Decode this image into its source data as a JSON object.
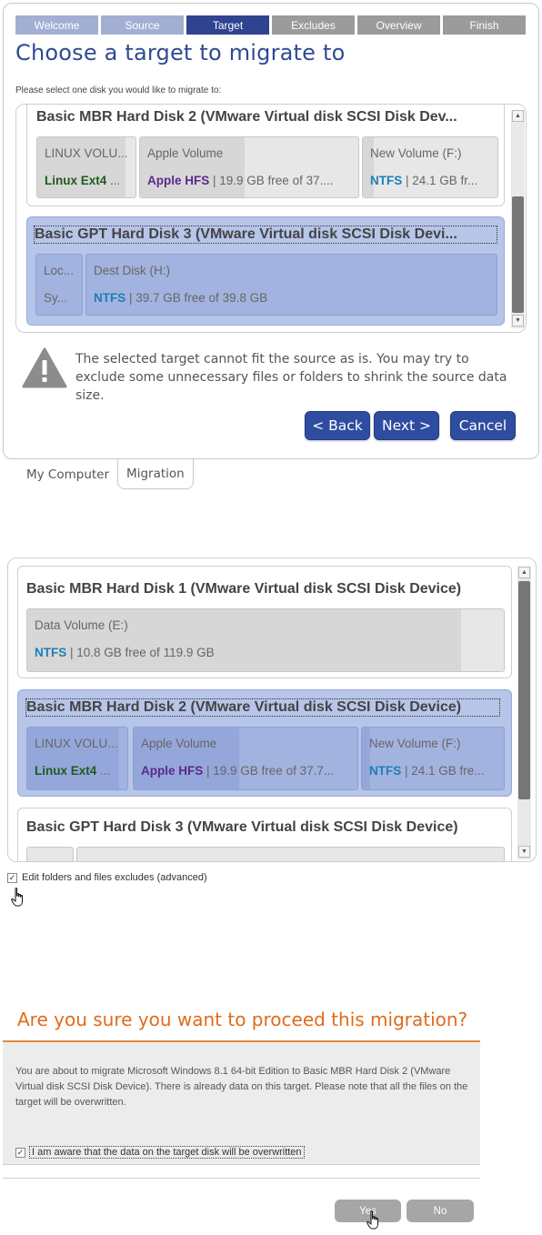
{
  "wizard": {
    "steps": [
      {
        "label": "Welcome",
        "state": "done"
      },
      {
        "label": "Source",
        "state": "done"
      },
      {
        "label": "Target",
        "state": "active"
      },
      {
        "label": "Excludes",
        "state": "todo"
      },
      {
        "label": "Overview",
        "state": "todo"
      },
      {
        "label": "Finish",
        "state": "todo"
      }
    ],
    "title": "Choose a target to migrate to",
    "subtitle": "Please select one disk you would like to migrate to:",
    "disks": [
      {
        "title": "Basic MBR Hard Disk 2 (VMware Virtual disk SCSI Disk Dev...",
        "volumes": [
          {
            "name": "LINUX VOLU...",
            "fs": "Linux Ext4",
            "info": " ..."
          },
          {
            "name": "Apple Volume",
            "fs": "Apple HFS",
            "info": " | 19.9 GB free of 37...."
          },
          {
            "name": "New Volume (F:)",
            "fs": "NTFS",
            "info": " | 24.1 GB fr..."
          }
        ]
      },
      {
        "title": "Basic GPT Hard Disk 3 (VMware Virtual disk SCSI Disk Devi...",
        "volumes": [
          {
            "name": "Loc...",
            "fs": "",
            "info": "Sy..."
          },
          {
            "name": "Dest Disk (H:)",
            "fs": "NTFS",
            "info": " | 39.7 GB free of 39.8 GB"
          }
        ]
      }
    ],
    "warning": "The selected target cannot fit the source as is. You may try to exclude some unnecessary files or folders to shrink the source data size.",
    "buttons": {
      "back": "< Back",
      "next": "Next >",
      "cancel": "Cancel"
    },
    "tabs": [
      "My Computer",
      "Migration"
    ]
  },
  "panel2": {
    "disks": [
      {
        "title": "Basic MBR Hard Disk 1 (VMware Virtual disk SCSI Disk Device)",
        "volumes": [
          {
            "name": "Data Volume (E:)",
            "fs": "NTFS",
            "info": " | 10.8 GB free of 119.9 GB",
            "used_fraction": 0.91
          }
        ]
      },
      {
        "title": "Basic MBR Hard Disk 2 (VMware Virtual disk SCSI Disk Device)",
        "volumes": [
          {
            "name": "LINUX VOLU...",
            "fs": "Linux Ext4",
            "info": " ..."
          },
          {
            "name": "Apple Volume",
            "fs": "Apple HFS",
            "info": " | 19.9 GB free of 37.7..."
          },
          {
            "name": "New Volume (F:)",
            "fs": "NTFS",
            "info": " | 24.1 GB fre..."
          }
        ]
      },
      {
        "title": "Basic GPT Hard Disk 3 (VMware Virtual disk SCSI Disk Device)",
        "volumes": []
      }
    ],
    "checkbox_label": "Edit folders and files excludes (advanced)",
    "checkbox_checked": "✓"
  },
  "dialog": {
    "title": "Are you sure you want to proceed this migration?",
    "message": "You are about to migrate Microsoft Windows 8.1 64-bit Edition to Basic MBR Hard Disk 2 (VMware Virtual disk SCSI Disk Device). There is already data on this target. Please note that all the files on the target will be overwritten.",
    "checkbox_label": "I am aware that the data on the target disk will be overwritten",
    "checkbox_checked": "✓",
    "buttons": {
      "yes": "Yes",
      "no": "No"
    }
  },
  "icons": {
    "warning": "warning-icon",
    "pointer": "hand-pointer-icon",
    "scroll_up": "scroll-up-icon",
    "scroll_down": "scroll-down-icon"
  }
}
